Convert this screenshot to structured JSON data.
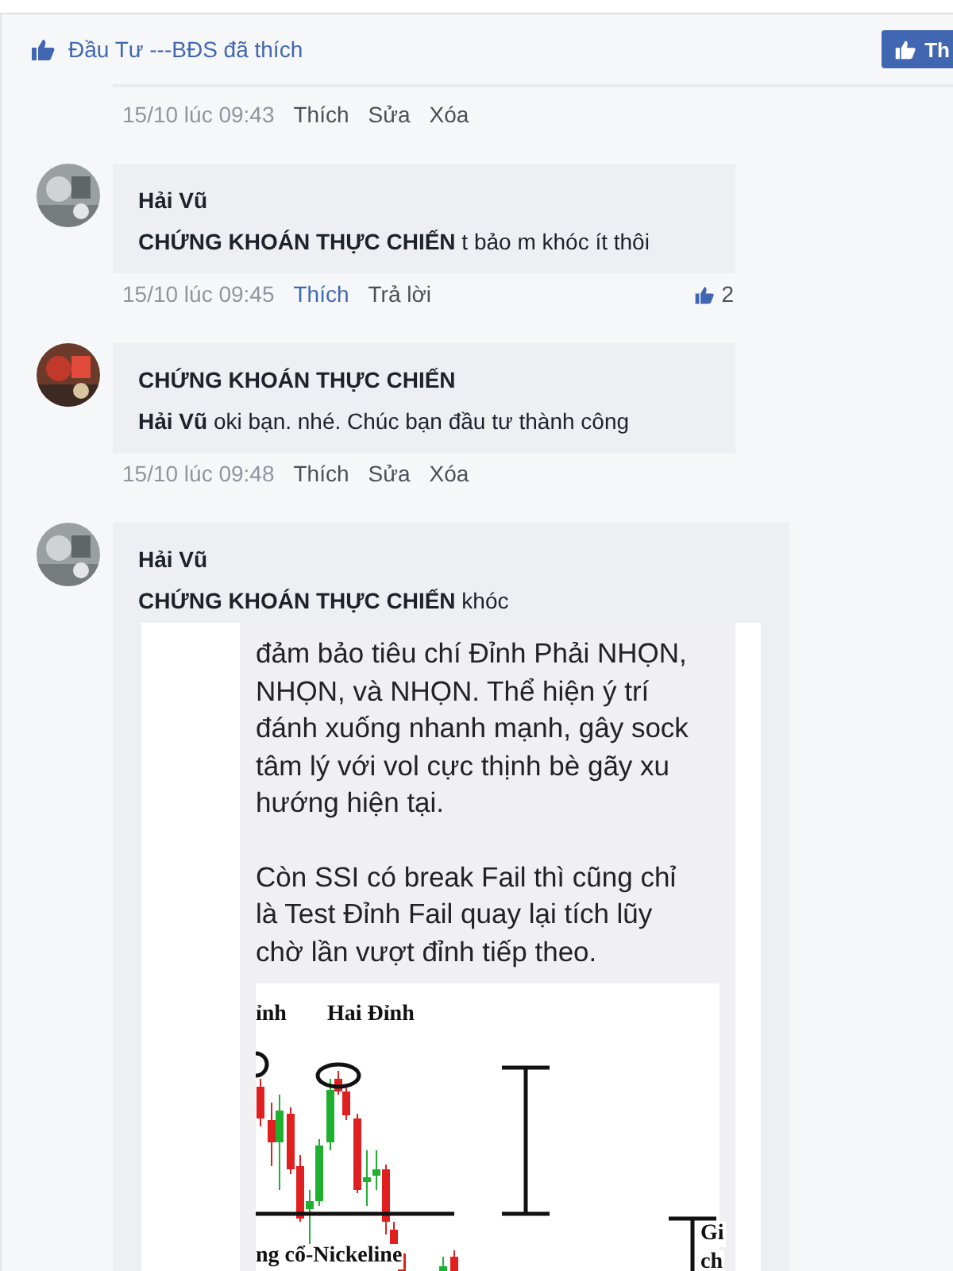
{
  "likes_bar": {
    "text": "Đầu Tư ---BĐS đã thích",
    "button": "Th"
  },
  "top_meta": {
    "time": "15/10 lúc 09:43",
    "actions": [
      {
        "label": "Thích",
        "selected": false
      },
      {
        "label": "Sửa",
        "selected": false
      },
      {
        "label": "Xóa",
        "selected": false
      }
    ]
  },
  "comments": [
    {
      "author": "Hải Vũ",
      "text": "**CHỨNG KHOÁN THỰC CHIẾN** t bảo m khóc ít thôi",
      "time": "15/10 lúc 09:45",
      "actions": [
        {
          "label": "Thích",
          "selected": true
        },
        {
          "label": "Trả lời",
          "selected": false
        }
      ],
      "like_count": "2"
    },
    {
      "author": "CHỨNG KHOÁN THỰC CHIẾN",
      "text": "**Hải Vũ** oki bạn. nhé. Chúc bạn đầu tư thành công",
      "time": "15/10 lúc 09:48",
      "actions": [
        {
          "label": "Thích",
          "selected": false
        },
        {
          "label": "Sửa",
          "selected": false
        },
        {
          "label": "Xóa",
          "selected": false
        }
      ]
    },
    {
      "author": "Hải Vũ",
      "text": "**CHỨNG KHOÁN THỰC CHIẾN** khóc",
      "attachment": {
        "kind": "screenshot",
        "paragraphs": [
          "đảm bảo tiêu chí Đỉnh Phải NHỌN, NHỌN, và NHỌN. Thể hiện ý trí đánh xuống nhanh mạnh, gây sock tâm lý với vol cực thịnh bè gãy xu hướng hiện tại.",
          "Còn SSI có break Fail thì cũng chỉ là Test Đỉnh Fail quay lại tích lũy chờ lần vượt đỉnh tiếp theo."
        ],
        "chart_labels": [
          "ỉnh",
          "Hai Đỉnh",
          "ng cổ-Nickeline",
          "Gi",
          "ch"
        ]
      }
    }
  ]
}
